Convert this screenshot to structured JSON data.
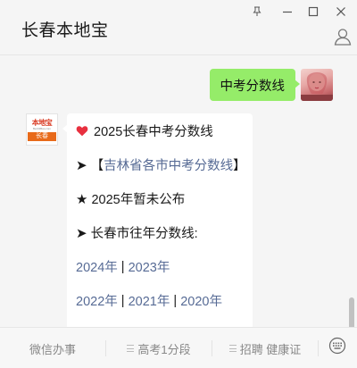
{
  "window": {
    "title": "长春本地宝",
    "pin_icon": "pin-icon",
    "minimize_icon": "minimize-icon",
    "maximize_icon": "maximize-icon",
    "close_icon": "close-icon",
    "profile_icon": "person-icon"
  },
  "chat": {
    "outgoing": {
      "text": "中考分数线"
    },
    "incoming": {
      "line1": {
        "icon": "heart-icon",
        "text": "2025长春中考分数线"
      },
      "line2": {
        "prefix": "➤ ",
        "bracket_open": "【",
        "link": "吉林省各市中考分数线",
        "bracket_close": "】"
      },
      "line3": {
        "prefix": "★ ",
        "text": "2025年暂未公布"
      },
      "line4": {
        "prefix": "➤ ",
        "text": "长春市往年分数线:"
      },
      "line5": {
        "link_2024": "2024年",
        "sep": " | ",
        "link_2023": "2023年"
      },
      "line6": {
        "link_2022": "2022年",
        "sep1": " | ",
        "link_2021": "2021年",
        "sep2": " | ",
        "link_2020": "2020年"
      }
    },
    "bot_avatar": {
      "top": "本地宝",
      "mid": "BenDiBao.com",
      "bottom": "长春"
    }
  },
  "bottom_menu": {
    "items": [
      "微信办事",
      "高考1分段",
      "招聘 健康证"
    ],
    "keyboard_icon": "keyboard-icon"
  },
  "colors": {
    "outgoing_bubble": "#95ec69",
    "link": "#576b95",
    "heart": "#e8303f",
    "background": "#f5f5f5"
  }
}
